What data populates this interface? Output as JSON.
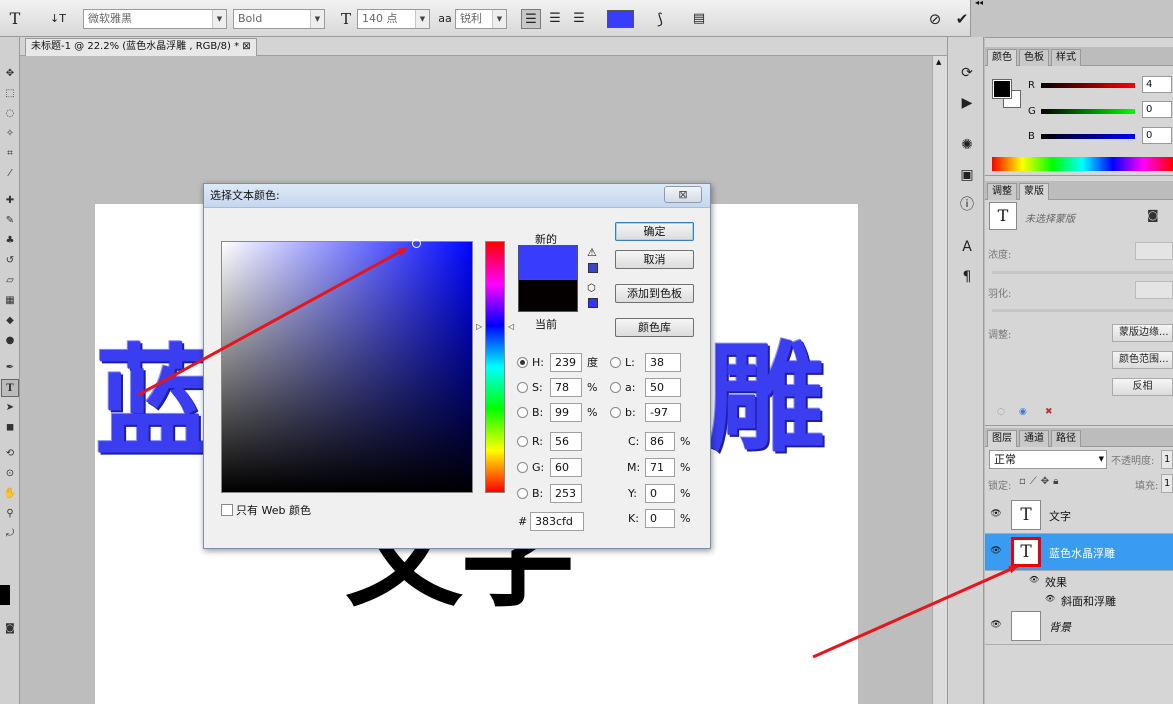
{
  "options_bar": {
    "tool_glyph": "T",
    "orient_glyph": "↓T",
    "font_family": "微软雅黑",
    "font_style": "Bold",
    "size_glyph": "T",
    "font_size": "140 点",
    "aa_glyph": "aa",
    "antialias": "锐利",
    "text_color": "#383cfd",
    "warp_glyph": "⟆",
    "panels_glyph": "▤",
    "cancel_glyph": "⊘",
    "commit_glyph": "✔"
  },
  "document": {
    "tab_title": "未标题-1 @ 22.2% (蓝色水晶浮雕 , RGB/8) *",
    "tab_close": "⊠"
  },
  "canvas": {
    "blue_left": "蓝",
    "blue_right": "雕",
    "black_text": "文字",
    "blue_color": "#3a3ef0"
  },
  "color_panel": {
    "tabs": [
      "颜色",
      "色板",
      "样式"
    ],
    "channels": [
      {
        "label": "R",
        "value": "4"
      },
      {
        "label": "G",
        "value": "0"
      },
      {
        "label": "B",
        "value": "0"
      }
    ]
  },
  "masks_panel": {
    "tabs": [
      "调整",
      "蒙版"
    ],
    "no_mask": "未选择蒙版",
    "density": "浓度:",
    "feather": "羽化:",
    "refine": "调整:",
    "edge_button": "蒙版边缘...",
    "color_range_button": "颜色范围...",
    "invert_button": "反相"
  },
  "layers_panel": {
    "tabs": [
      "图层",
      "通道",
      "路径"
    ],
    "blend_mode": "正常",
    "opacity_label": "不透明度:",
    "opacity_value": "1",
    "lock_label": "锁定:",
    "fill_label": "填充:",
    "fill_value": "1",
    "layers": [
      {
        "name": "文字",
        "thumb": "T"
      },
      {
        "name": "蓝色水晶浮雕",
        "thumb": "T"
      },
      {
        "name": "背景",
        "thumb": ""
      }
    ],
    "effects_label": "效果",
    "effect_item": "斜面和浮雕"
  },
  "dialog": {
    "title": "选择文本颜色:",
    "close": "⊠",
    "new_label": "新的",
    "current_label": "当前",
    "new_color": "#383cfd",
    "current_color": "#040000",
    "ok": "确定",
    "cancel": "取消",
    "add_swatch": "添加到色板",
    "color_library": "颜色库",
    "web_only": "只有 Web 颜色",
    "hsb": [
      {
        "label": "H:",
        "value": "239",
        "unit": "度"
      },
      {
        "label": "S:",
        "value": "78",
        "unit": "%"
      },
      {
        "label": "B:",
        "value": "99",
        "unit": "%"
      }
    ],
    "rgb": [
      {
        "label": "R:",
        "value": "56"
      },
      {
        "label": "G:",
        "value": "60"
      },
      {
        "label": "B:",
        "value": "253"
      }
    ],
    "lab": [
      {
        "label": "L:",
        "value": "38"
      },
      {
        "label": "a:",
        "value": "50"
      },
      {
        "label": "b:",
        "value": "-97"
      }
    ],
    "cmyk": [
      {
        "label": "C:",
        "value": "86",
        "unit": "%"
      },
      {
        "label": "M:",
        "value": "71",
        "unit": "%"
      },
      {
        "label": "Y:",
        "value": "0",
        "unit": "%"
      },
      {
        "label": "K:",
        "value": "0",
        "unit": "%"
      }
    ],
    "hex_label": "#",
    "hex_value": "383cfd"
  }
}
